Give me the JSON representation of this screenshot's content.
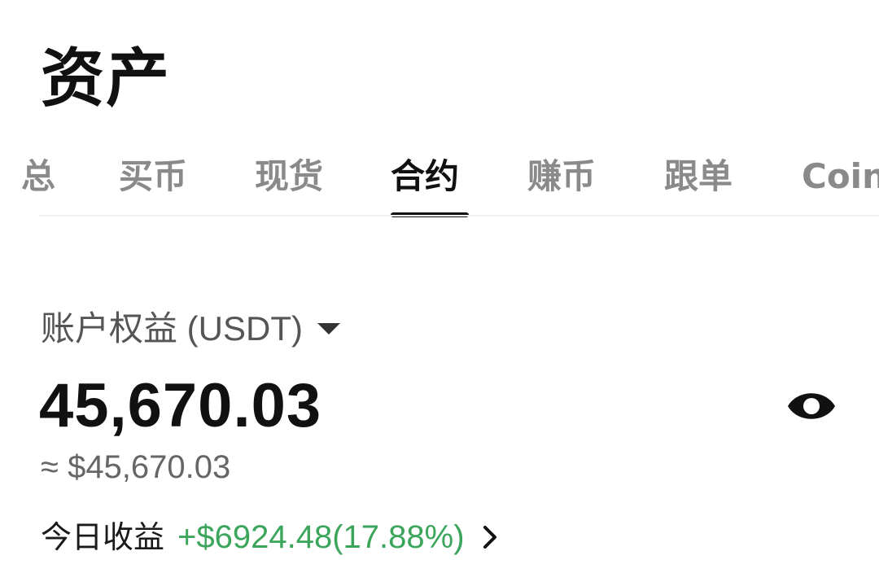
{
  "header": {
    "title": "资产"
  },
  "tabs": [
    {
      "label": "总"
    },
    {
      "label": "买币"
    },
    {
      "label": "现货"
    },
    {
      "label": "合约",
      "active": true
    },
    {
      "label": "赚币"
    },
    {
      "label": "跟单"
    },
    {
      "label": "Coin"
    }
  ],
  "account": {
    "equity_label": "账户权益 (USDT)",
    "balance": "45,670.03",
    "usd_approx": "≈ $45,670.03",
    "todays_pnl_label": "今日收益",
    "todays_pnl_value": "+$6924.48(17.88%)"
  },
  "icons": {
    "equity_dropdown": "caret-down-icon",
    "visibility": "eye-icon",
    "pnl_detail": "chevron-right-icon"
  },
  "colors": {
    "positive": "#3ca55c",
    "active_tab": "#111111",
    "inactive_tab": "#8a8a8a"
  }
}
